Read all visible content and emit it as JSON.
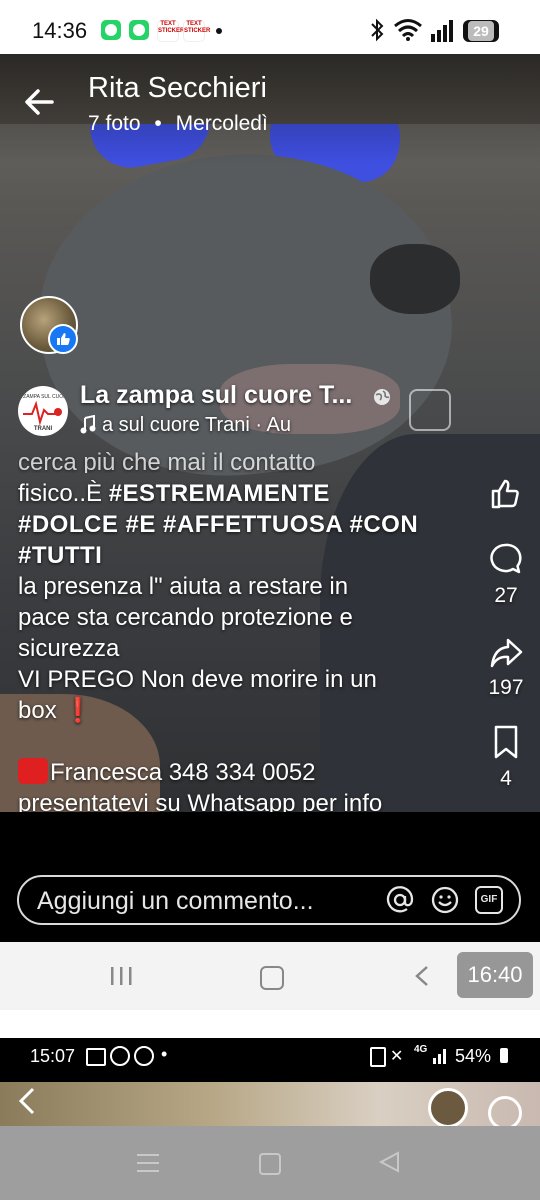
{
  "status_bar": {
    "time": "14:36",
    "battery": "29",
    "dot": "•"
  },
  "header": {
    "name": "Rita Secchieri",
    "photos": "7 foto",
    "sep": "•",
    "day": "Mercoledì"
  },
  "page": {
    "name": "La zampa sul cuore T...",
    "subline": "a sul cuore Trani · Au",
    "logo_text": "LA ZAMPA SUL CUORE TRANI"
  },
  "caption": {
    "faded_line": "cerca più che mai il contatto",
    "line1_plain": "fisico..È ",
    "line1_bold": "#ESTREMAMENTE",
    "line2_bold": "#DOLCE #E #AFFETTUOSA #CON",
    "line3_bold": "#TUTTI",
    "line4": "la presenza  l\" aiuta a restare in",
    "line5": "pace sta cercando protezione e",
    "line6": "sicurezza",
    "line7": "VI PREGO Non deve morire in un",
    "line8": "box ",
    "exclamation": "❗",
    "line9": "Francesca  348 334 0052",
    "line10": "presentatevi su Whatsapp  per info"
  },
  "actions": {
    "like_count": "",
    "comment_count": "27",
    "share_count": "197",
    "save_count": "4",
    "more": "•••"
  },
  "comment_bar": {
    "placeholder": "Aggiungi un commento...",
    "gif_label": "GIF"
  },
  "nav_bar": {
    "time": "16:40"
  },
  "status_bar_2": {
    "time": "15:07",
    "dot": "•",
    "battery": "54%",
    "net": "4G"
  },
  "colors": {
    "glove": "#3f4fe0",
    "facebook_blue": "#1877f2",
    "red_square": "#e02020"
  },
  "icons": [
    "back-arrow-icon",
    "globe-icon",
    "music-note-icon",
    "like-icon",
    "comment-icon",
    "share-icon",
    "bookmark-icon",
    "more-icon",
    "at-icon",
    "emoji-icon",
    "gif-icon",
    "recents-icon",
    "home-icon",
    "back-icon"
  ]
}
